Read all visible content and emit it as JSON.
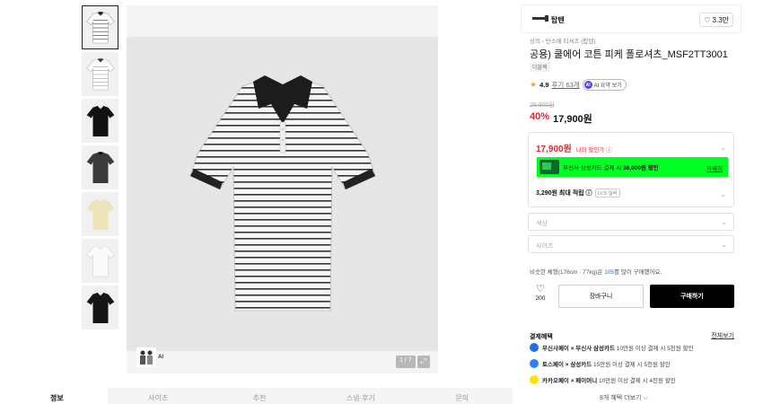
{
  "gallery": {
    "thumb_count": 7,
    "pager": "1 / 7",
    "ai_label": "AI"
  },
  "tabs": [
    {
      "label": "정보"
    },
    {
      "label": "사이즈"
    },
    {
      "label": "추천"
    },
    {
      "label": "스냅·후기"
    },
    {
      "label": "문의"
    }
  ],
  "brand": {
    "name": "탑텐",
    "likes": "3.3만"
  },
  "breadcrumb": "상의 › 반소매 티셔츠 (탑텐)",
  "product": {
    "title": "공용) 쿨에어 코튼 피케 폴로셔츠_MSF2TT3001",
    "chip": "더블팩",
    "rating": "4.9",
    "reviews": "후기 63개",
    "ai_summary": "AI 요약 보기",
    "original_price": "29,900원",
    "discount": "40%",
    "price": "17,900원"
  },
  "benefit": {
    "my_price": "17,900원",
    "my_price_label": "나의 할인가 ⓘ",
    "card_text_pre": "무신사 삼성카드 결제 시 ",
    "card_text_bold": "36,000원 할인",
    "card_link": "자세히",
    "points": "3,290원 최대 적립 ⓘ",
    "level": "LV.5 실버"
  },
  "options": {
    "color": "색상",
    "size": "사이즈"
  },
  "hint": {
    "pre": "비슷한 체형(176cm · 77kg)은 ",
    "highlight": "105",
    "post": "를 많이 구매했어요."
  },
  "actions": {
    "wish_count": "200",
    "cart": "장바구니",
    "buy": "구매하기"
  },
  "payment": {
    "title": "결제혜택",
    "all": "전체보기",
    "items": [
      {
        "bold": "무신사페이 × 무신사 삼성카드",
        "text": " 10만원 이상 결제 시 5천원 할인",
        "color": "#1f6fe5"
      },
      {
        "bold": "토스페이 × 삼성카드",
        "text": " 15만원 이상 결제 시 5천원 할인",
        "color": "#2f80ff"
      },
      {
        "bold": "카카오페이 × 페이머니",
        "text": " 10만원 이상 결제 시 4천원 할인",
        "color": "#ffe000"
      }
    ],
    "more": "8개 혜택 더보기 ⌵"
  }
}
